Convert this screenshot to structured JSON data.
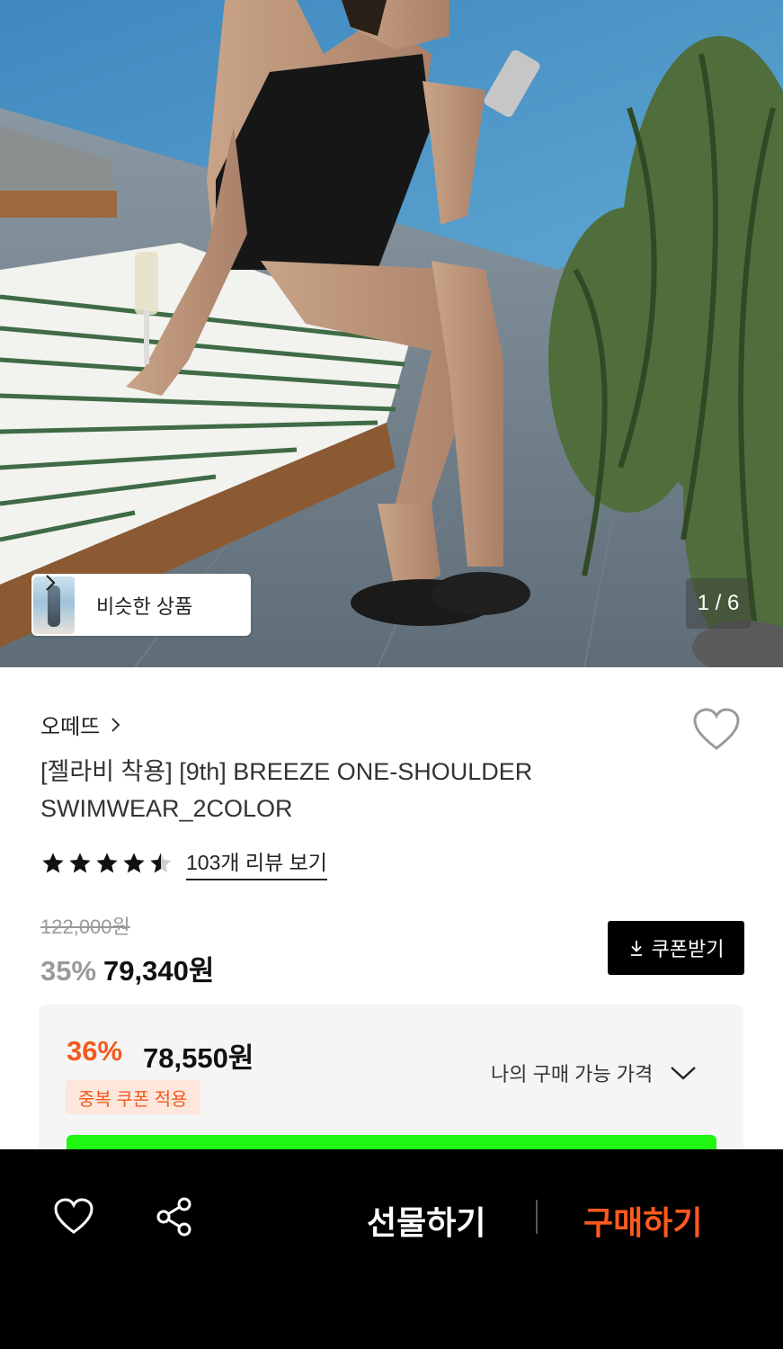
{
  "hero": {
    "similar_label": "비슷한 상품",
    "counter": "1 / 6"
  },
  "product": {
    "brand": "오떼뜨",
    "title": "[젤라비 착용] [9th] BREEZE ONE-SHOULDER SWIMWEAR_2COLOR",
    "rating": 4.5,
    "review_link": "103개 리뷰 보기",
    "original_price": "122,000원",
    "discount": "35%",
    "price": "79,340원",
    "coupon_button": "쿠폰받기"
  },
  "my_price": {
    "discount": "36%",
    "price": "78,550원",
    "badge": "중복 쿠폰 적용",
    "label": "나의 구매 가능 가격"
  },
  "bottom_bar": {
    "gift_label": "선물하기",
    "buy_label": "구매하기"
  },
  "colors": {
    "accent": "#f25a1e",
    "buy": "#ff5a1f",
    "highlight_bar": "#1ef711"
  },
  "icons": [
    "chevron-right-icon",
    "heart-icon",
    "star-icon",
    "download-icon",
    "chevron-down-icon",
    "share-icon"
  ]
}
